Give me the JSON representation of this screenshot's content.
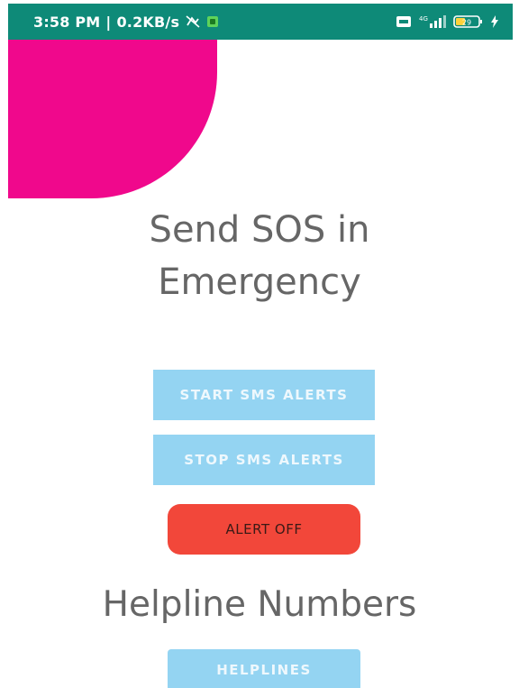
{
  "status_bar": {
    "time": "3:58 PM",
    "separator": "|",
    "speed": "0.2KB/s",
    "network_label": "4G",
    "battery": "29",
    "color": "#0e8a78"
  },
  "main": {
    "headline_line1": "Send SOS in",
    "headline_line2": "Emergency",
    "start_label": "START SMS ALERTS",
    "stop_label": "STOP SMS ALERTS",
    "alert_label": "ALERT OFF",
    "helpline_title": "Helpline Numbers",
    "helplines_label": "HELPLINES"
  },
  "colors": {
    "accent_pink": "#f0088c",
    "button_blue": "#94d4f2",
    "alert_red": "#f2473a",
    "heading_gray": "#666666"
  }
}
